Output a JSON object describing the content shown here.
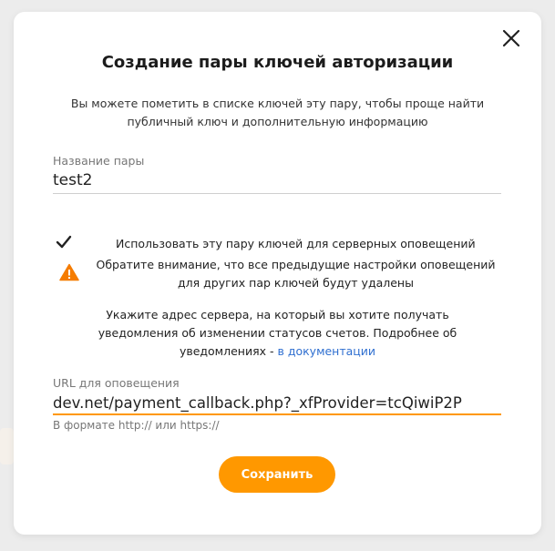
{
  "modal": {
    "title": "Создание пары ключей авторизации",
    "description": "Вы можете пометить в списке ключей эту пару, чтобы проще найти публичный ключ и дополнительную информацию",
    "pair_name": {
      "label": "Название пары",
      "value": "test2"
    },
    "notifications_checkbox": {
      "checked": true,
      "label": "Использовать эту пару ключей для серверных оповещений"
    },
    "warning_text": "Обратите внимание, что все предыдущие настройки оповещений для других пар ключей будут удалены",
    "info_text": "Укажите адрес сервера, на который вы хотите получать уведомления об изменении статусов счетов. Подробнее об уведомлениях -",
    "doc_link": "в документации",
    "url_field": {
      "label": "URL для оповещения",
      "value": "dev.net/payment_callback.php?_xfProvider=tcQiwiP2P",
      "hint": "В формате http:// или https://"
    },
    "save_button": "Сохранить"
  },
  "colors": {
    "accent": "#ff9800",
    "link": "#2f6fd0",
    "warning": "#f57c00"
  },
  "icons": {
    "close": "close-icon",
    "check": "checkmark-icon",
    "warning": "warning-triangle-icon"
  }
}
